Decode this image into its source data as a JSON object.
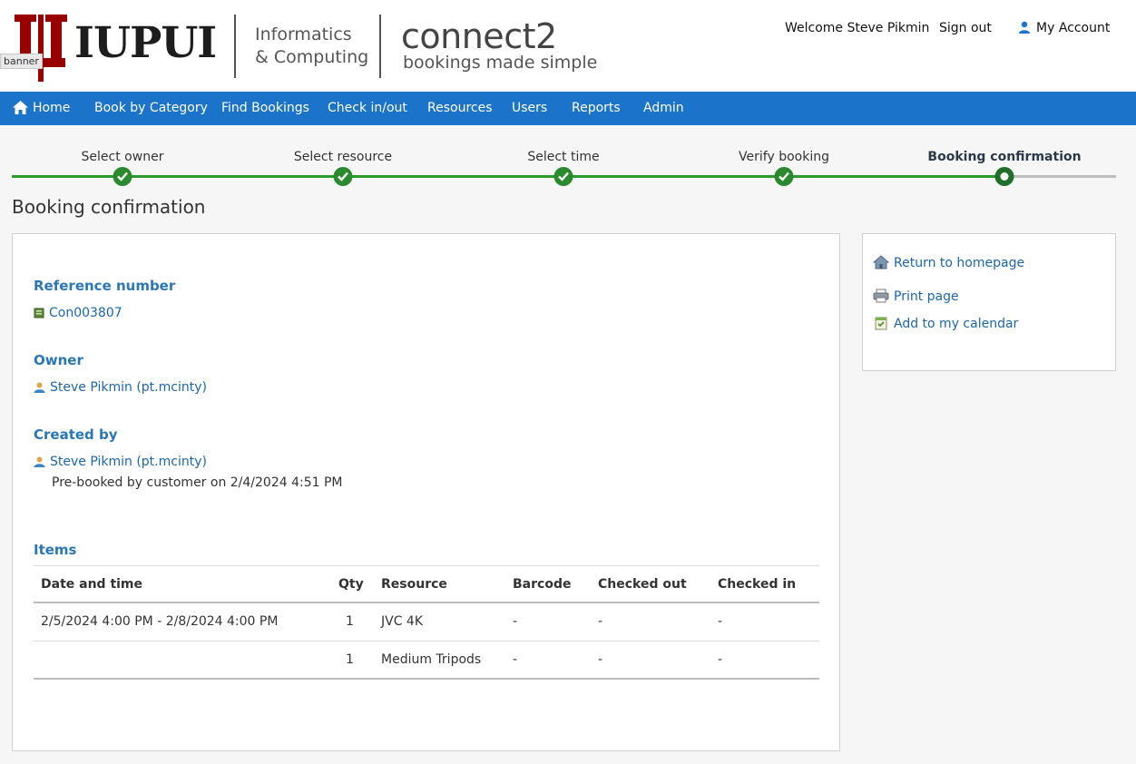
{
  "header": {
    "tooltip": "banner",
    "logo_text": "IUPUI",
    "school_line1": "Informatics",
    "school_line2": "& Computing",
    "brand": "connect2",
    "tagline": "bookings made simple",
    "welcome": "Welcome Steve Pikmin",
    "sign_out": "Sign out",
    "my_account": "My Account"
  },
  "nav": {
    "items": [
      "Home",
      "Book by Category",
      "Find Bookings",
      "Check in/out",
      "Resources",
      "Users",
      "Reports",
      "Admin"
    ]
  },
  "steps": {
    "items": [
      "Select owner",
      "Select resource",
      "Select time",
      "Verify booking",
      "Booking confirmation"
    ],
    "completed_count": 4,
    "current_index": 4
  },
  "page": {
    "title": "Booking confirmation"
  },
  "booking": {
    "reference_heading": "Reference number",
    "reference": "Con003807",
    "owner_heading": "Owner",
    "owner": "Steve Pikmin (pt.mcinty)",
    "created_heading": "Created by",
    "created_by": "Steve Pikmin (pt.mcinty)",
    "created_note": "Pre-booked by customer on 2/4/2024 4:51 PM",
    "items_heading": "Items",
    "columns": [
      "Date and time",
      "Qty",
      "Resource",
      "Barcode",
      "Checked out",
      "Checked in"
    ],
    "rows": [
      [
        "2/5/2024 4:00 PM - 2/8/2024 4:00 PM",
        "1",
        "JVC 4K",
        "-",
        "-",
        "-"
      ],
      [
        "",
        "1",
        "Medium Tripods",
        "-",
        "-",
        "-"
      ]
    ]
  },
  "side": {
    "return_home": "Return to homepage",
    "print_page": "Print page",
    "add_calendar": "Add to my calendar"
  },
  "colors": {
    "nav_blue": "#1b74c9",
    "step_green": "#2a8a2d",
    "heading_blue": "#2a77b8",
    "iu_crimson": "#990000"
  }
}
